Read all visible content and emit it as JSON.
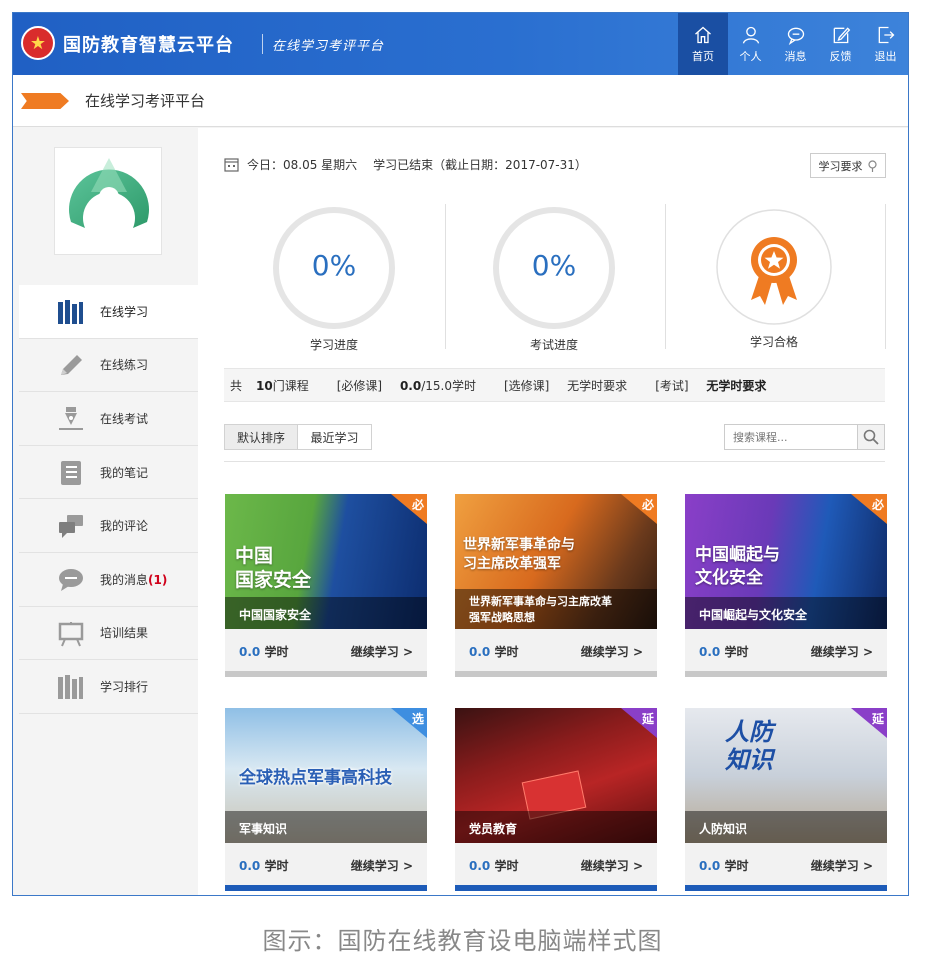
{
  "header": {
    "site_name": "国防教育智慧云平台",
    "site_sub": "在线学习考评平台",
    "nav": [
      {
        "label": "首页",
        "icon": "home-icon"
      },
      {
        "label": "个人",
        "icon": "user-icon"
      },
      {
        "label": "消息",
        "icon": "message-icon"
      },
      {
        "label": "反馈",
        "icon": "feedback-icon"
      },
      {
        "label": "退出",
        "icon": "logout-icon"
      }
    ]
  },
  "titlebar": {
    "title": "在线学习考评平台"
  },
  "sidebar": {
    "items": [
      {
        "label": "在线学习",
        "icon": "books-icon",
        "active": true
      },
      {
        "label": "在线练习",
        "icon": "pencil-icon"
      },
      {
        "label": "在线考试",
        "icon": "pen-nib-icon"
      },
      {
        "label": "我的笔记",
        "icon": "notebook-icon"
      },
      {
        "label": "我的评论",
        "icon": "comments-icon"
      },
      {
        "label": "我的消息",
        "icon": "chat-icon",
        "badge": "(1)"
      },
      {
        "label": "培训结果",
        "icon": "easel-icon"
      },
      {
        "label": "学习排行",
        "icon": "ranking-icon"
      }
    ]
  },
  "main": {
    "date_text": "今日：08.05  星期六",
    "status_text": "学习已结束（截止日期：2017-07-31）",
    "req_label": "学习要求",
    "stats": [
      {
        "value": "0%",
        "label": "学习进度",
        "percent": 0
      },
      {
        "value": "0%",
        "label": "考试进度",
        "percent": 0
      },
      {
        "label": "学习合格"
      }
    ],
    "summary": {
      "courses_pre": "共",
      "courses_num": "10",
      "courses_post": "门课程",
      "required_pre": "[必修课]",
      "required_done": "0.0",
      "required_total": "/15.0学时",
      "elective_pre": "[选修课]",
      "elective_val": "无学时要求",
      "exam_pre": "[考试]",
      "exam_val": "无学时要求"
    },
    "sort": {
      "default_label": "默认排序",
      "recent_label": "最近学习"
    },
    "search": {
      "placeholder": "搜索课程..."
    }
  },
  "courses": [
    {
      "caption": "中国国家安全",
      "big": "中国\n国家安全",
      "tag": "必",
      "tag_color": "#ef7b22",
      "hours": "0.0",
      "hours_unit": "学时",
      "continue": "继续学习 >",
      "bar_color": "#c8c8c8"
    },
    {
      "caption": "世界新军事革命与习主席改革\n强军战略思想",
      "big": "世界新军事革命与\n习主席改革强军",
      "tag": "必",
      "tag_color": "#ef7b22",
      "hours": "0.0",
      "hours_unit": "学时",
      "continue": "继续学习 >",
      "bar_color": "#c8c8c8"
    },
    {
      "caption": "中国崛起与文化安全",
      "big": "中国崛起与\n文化安全",
      "tag": "必",
      "tag_color": "#ef7b22",
      "hours": "0.0",
      "hours_unit": "学时",
      "continue": "继续学习 >",
      "bar_color": "#c8c8c8"
    },
    {
      "caption": "军事知识",
      "big": "全球热点军事高科技",
      "tag": "选",
      "tag_color": "#3e8ee0",
      "hours": "0.0",
      "hours_unit": "学时",
      "continue": "继续学习 >",
      "bar_color": "#1d5bb8"
    },
    {
      "caption": "党员教育",
      "big": "",
      "tag": "延",
      "tag_color": "#8a3fc8",
      "hours": "0.0",
      "hours_unit": "学时",
      "continue": "继续学习 >",
      "bar_color": "#1d5bb8"
    },
    {
      "caption": "人防知识",
      "big": "人防\n知识",
      "tag": "延",
      "tag_color": "#8a3fc8",
      "hours": "0.0",
      "hours_unit": "学时",
      "continue": "继续学习 >",
      "bar_color": "#1d5bb8"
    }
  ],
  "footer_caption": "图示：国防在线教育设电脑端样式图"
}
